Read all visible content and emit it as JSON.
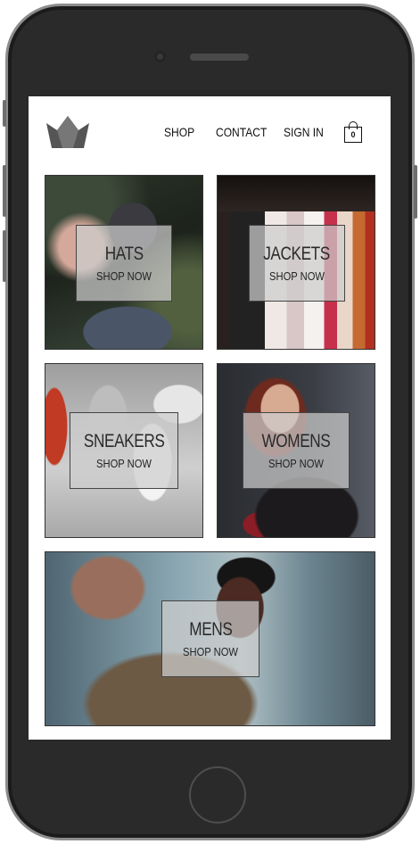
{
  "header": {
    "nav": [
      "SHOP",
      "CONTACT",
      "SIGN IN"
    ],
    "cart_count": "0",
    "logo_icon": "crown-icon"
  },
  "tiles": [
    {
      "category": "HATS",
      "cta": "SHOP NOW"
    },
    {
      "category": "JACKETS",
      "cta": "SHOP NOW"
    },
    {
      "category": "SNEAKERS",
      "cta": "SHOP NOW"
    },
    {
      "category": "WOMENS",
      "cta": "SHOP NOW"
    },
    {
      "category": "MENS",
      "cta": "SHOP NOW"
    }
  ],
  "colors": {
    "screen_background": "#ffffff",
    "overlay": "#cdcdcd",
    "text": "#222222",
    "device": "#2a2a2a"
  }
}
